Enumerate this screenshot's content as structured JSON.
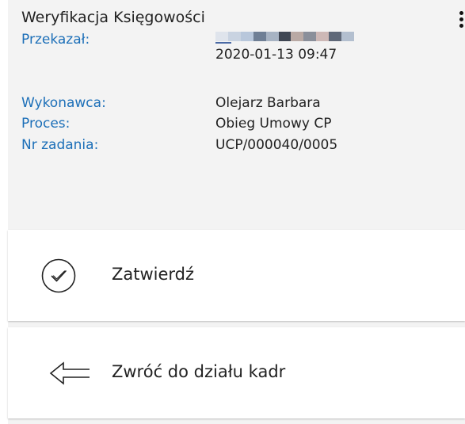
{
  "panel": {
    "title": "Weryfikacja Księgowości",
    "menu_icon": "kebab-menu-icon"
  },
  "details": {
    "przekazal_label": "Przekazał:",
    "przekazal_name_redacted": true,
    "przekazal_date": "2020-01-13 09:47",
    "wykonawca_label": "Wykonawca:",
    "wykonawca_value": "Olejarz Barbara",
    "proces_label": "Proces:",
    "proces_value": "Obieg Umowy CP",
    "nr_label": "Nr zadania:",
    "nr_value": "UCP/000040/0005"
  },
  "actions": {
    "confirm_label": "Zatwierdź",
    "confirm_icon": "check-circle-icon",
    "return_label": "Zwróć do działu kadr",
    "return_icon": "arrow-left-outline-icon"
  },
  "colors": {
    "label": "#1c6fb8",
    "text": "#222222",
    "panel_bg": "#f3f3f3",
    "button_bg": "#ffffff"
  }
}
